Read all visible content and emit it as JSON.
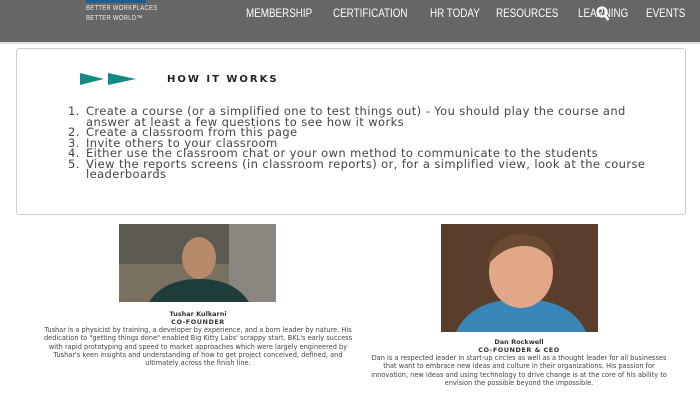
{
  "header": {
    "logo_lines": [
      "BETTER WORKPLACES",
      "BETTER WORLD™"
    ],
    "nav": [
      "MEMBERSHIP",
      "CERTIFICATION",
      "HR TODAY",
      "RESOURCES",
      "LEARNING",
      "EVENTS"
    ],
    "search_icon": "search-icon",
    "bg_color": "#666666"
  },
  "how_it_works": {
    "title": "HOW IT WORKS",
    "accent_color": "#138a82",
    "steps": [
      {
        "n": "1.",
        "text": "Create a course (or a simplified one to test things out) - You should play the course and answer at least a few questions to see how it works"
      },
      {
        "n": "2.",
        "text": "Create a classroom from this page"
      },
      {
        "n": "3.",
        "text": "Invite others to your classroom"
      },
      {
        "n": "4.",
        "text": "Either use the classroom chat or your own method to communicate to the students"
      },
      {
        "n": "5.",
        "text": "View the reports screens (in classroom reports) or, for a simplified view, look at the course leaderboards"
      }
    ]
  },
  "people": [
    {
      "name": "Tushar Kulkarni",
      "title": "CO-FOUNDER",
      "bio": "Tushar is a physicist by training, a developer by experience, and a born leader by nature. His dedication to \"getting things done\" enabled Big Kitty Labs' scrappy start. BKL's early success with rapid prototyping and speed to market approaches which were largely engineered by Tushar's keen insights and understanding of how to get project conceived, defined, and ultimately across the finish line."
    },
    {
      "name": "Dan Rockwell",
      "title": "CO-FOUNDER & CEO",
      "bio": "Dan is a respected leader in start-up circles as well as a thought leader for all businesses that want to embrace new ideas and culture in their organizations. His passion for innovation, new ideas and using technology to drive change is at the core of his ability to envision the possible beyond the impossible."
    }
  ]
}
